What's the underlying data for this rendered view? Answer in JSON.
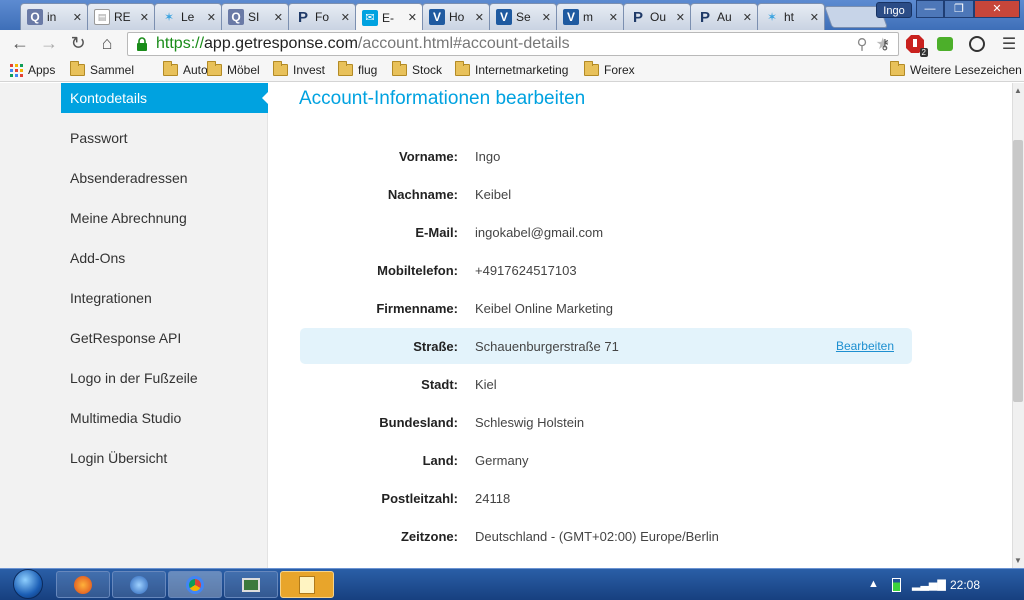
{
  "browser": {
    "tabs": [
      {
        "label": "in",
        "icon": "search-tab-icon"
      },
      {
        "label": "RE",
        "icon": "page-tab-icon"
      },
      {
        "label": "Le",
        "icon": "bird-tab-icon"
      },
      {
        "label": "SI",
        "icon": "search-tab-icon"
      },
      {
        "label": "Fo",
        "icon": "p-tab-icon"
      },
      {
        "label": "E-",
        "icon": "mail-tab-icon",
        "active": true
      },
      {
        "label": "Ho",
        "icon": "v-tab-icon"
      },
      {
        "label": "Se",
        "icon": "v-tab-icon"
      },
      {
        "label": "m",
        "icon": "v-tab-icon"
      },
      {
        "label": "Ou",
        "icon": "p-tab-icon"
      },
      {
        "label": "Au",
        "icon": "p-tab-icon"
      },
      {
        "label": "ht",
        "icon": "bird-tab-icon"
      }
    ],
    "user_badge": "Ingo",
    "url": {
      "scheme": "https://",
      "host": "app.getresponse.com",
      "path": "/account.html#account-details"
    },
    "extension_badge": "2",
    "bookmarks": {
      "apps_label": "Apps",
      "items": [
        "Sammel",
        "Auto",
        "Möbel",
        "Invest",
        "flug",
        "Stock",
        "Internetmarketing",
        "Forex"
      ],
      "other_label": "Weitere Lesezeichen"
    }
  },
  "sidebar": {
    "items": [
      {
        "label": "Kontodetails",
        "active": true
      },
      {
        "label": "Passwort"
      },
      {
        "label": "Absenderadressen"
      },
      {
        "label": "Meine Abrechnung"
      },
      {
        "label": "Add-Ons"
      },
      {
        "label": "Integrationen"
      },
      {
        "label": "GetResponse API"
      },
      {
        "label": "Logo in der Fußzeile"
      },
      {
        "label": "Multimedia Studio"
      },
      {
        "label": "Login Übersicht"
      }
    ]
  },
  "main": {
    "title": "Account-Informationen bearbeiten",
    "fields": [
      {
        "label": "Vorname:",
        "value": "Ingo"
      },
      {
        "label": "Nachname:",
        "value": "Keibel"
      },
      {
        "label": "E-Mail:",
        "value": "ingokabel@gmail.com"
      },
      {
        "label": "Mobiltelefon:",
        "value": "+4917624517103"
      },
      {
        "label": "Firmenname:",
        "value": "Keibel Online Marketing"
      },
      {
        "label": "Straße:",
        "value": "Schauenburgerstraße 71",
        "highlight": true,
        "action": "Bearbeiten"
      },
      {
        "label": "Stadt:",
        "value": "Kiel"
      },
      {
        "label": "Bundesland:",
        "value": "Schleswig Holstein"
      },
      {
        "label": "Land:",
        "value": "Germany"
      },
      {
        "label": "Postleitzahl:",
        "value": "24118"
      },
      {
        "label": "Zeitzone:",
        "value": "Deutschland - (GMT+02:00) Europe/Berlin"
      }
    ]
  },
  "taskbar": {
    "clock": "22:08"
  },
  "colors": {
    "accent": "#00a2e0",
    "highlight_row": "#e3f3fb",
    "link": "#1d8fd0"
  }
}
